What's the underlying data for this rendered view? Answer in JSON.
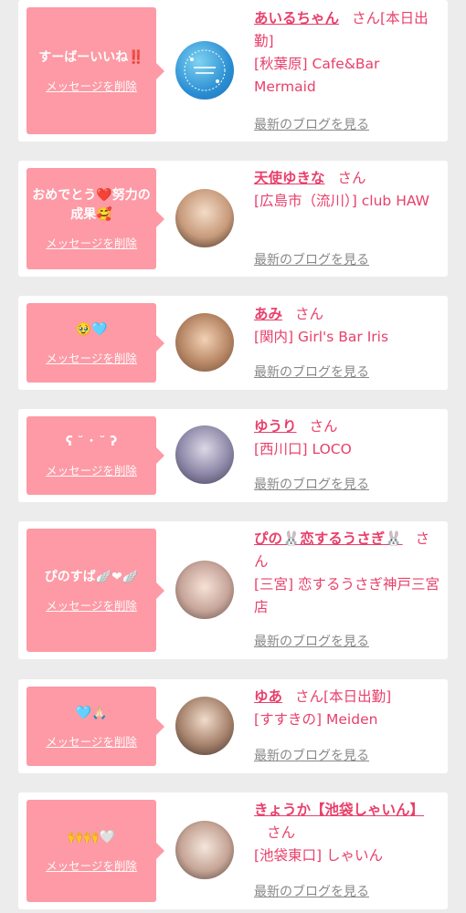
{
  "page": {
    "delete_label": "メッセージを削除",
    "blog_label": "最新のブログを見る",
    "san": "さん"
  },
  "colors": {
    "accent": "#e8406b",
    "bubble": "#fd9aa5"
  },
  "cards": [
    {
      "message": "すーばーいいね‼️",
      "name": "あいるちゃん",
      "suffix": "さん[本日出勤]",
      "shop": "[秋葉原] Cafe&Bar Mermaid",
      "avatar_icon": "photo-preparing-icon"
    },
    {
      "message": "おめでとう❤️努力の成果🥰",
      "name": "天使ゆきな",
      "suffix": "さん",
      "shop": "[広島市（流川）] club HAW",
      "avatar_icon": "avatar"
    },
    {
      "message": "🥹🩵",
      "name": "あみ",
      "suffix": "さん",
      "shop": "[関内] Girl's Bar Iris",
      "avatar_icon": "avatar"
    },
    {
      "message": "ʕ ˘ ･ ˘ ʔ",
      "name": "ゆうり",
      "suffix": "さん",
      "shop": "[西川口] LOCO",
      "avatar_icon": "avatar"
    },
    {
      "message": "ぴのすば🪽❤︎🪽",
      "name": "ぴの🐰恋するうさぎ🐰",
      "suffix": "さん",
      "shop": "[三宮] 恋するうさぎ神戸三宮店",
      "avatar_icon": "avatar"
    },
    {
      "message": "🩵🙏🏻",
      "name": "ゆあ",
      "suffix": "さん[本日出勤]",
      "shop": "[すすきの] Meiden",
      "avatar_icon": "avatar"
    },
    {
      "message": "🙌🙌🤍",
      "name": "きょうか【池袋しゃいん】",
      "suffix": "さん",
      "shop": "[池袋東口] しゃいん",
      "avatar_icon": "avatar"
    }
  ]
}
